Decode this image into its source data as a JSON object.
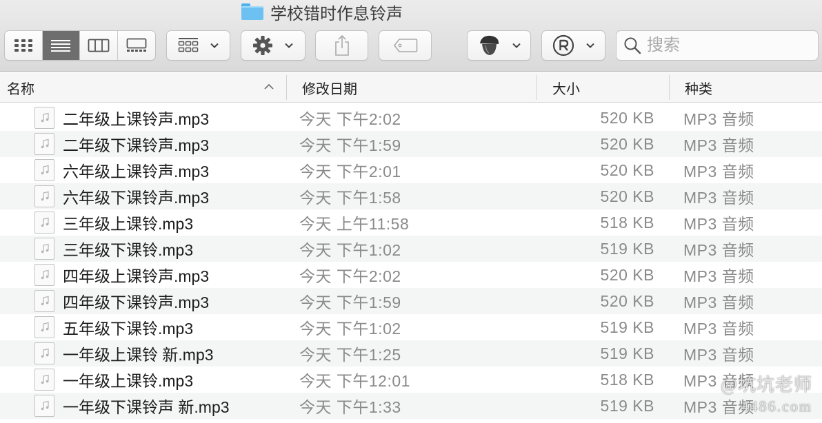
{
  "window": {
    "title": "学校错时作息铃声",
    "folder_icon": "folder-icon"
  },
  "toolbar": {
    "view_modes": [
      {
        "name": "icon-view",
        "icon": "grid-icon",
        "active": false
      },
      {
        "name": "list-view",
        "icon": "list-icon",
        "active": true
      },
      {
        "name": "column-view",
        "icon": "columns-icon",
        "active": false
      },
      {
        "name": "gallery-view",
        "icon": "gallery-icon",
        "active": false
      }
    ],
    "group_button_icon": "group-icon",
    "action_button_icon": "gear-icon",
    "share_button_icon": "share-icon",
    "tag_button_icon": "tag-icon",
    "acorn_button_icon": "acorn-icon",
    "registered_button_icon": "registered-icon",
    "search": {
      "placeholder": "搜索",
      "value": ""
    }
  },
  "columns": {
    "name": "名称",
    "date": "修改日期",
    "size": "大小",
    "kind": "种类",
    "sort_column": "name",
    "sort_direction": "ascending"
  },
  "files": [
    {
      "name": "二年级上课铃声.mp3",
      "date": "今天 下午2:02",
      "size": "520 KB",
      "kind": "MP3 音频"
    },
    {
      "name": "二年级下课铃声.mp3",
      "date": "今天 下午1:59",
      "size": "520 KB",
      "kind": "MP3 音频"
    },
    {
      "name": "六年级上课铃声.mp3",
      "date": "今天 下午2:01",
      "size": "520 KB",
      "kind": "MP3 音频"
    },
    {
      "name": "六年级下课铃声.mp3",
      "date": "今天 下午1:58",
      "size": "520 KB",
      "kind": "MP3 音频"
    },
    {
      "name": "三年级上课铃.mp3",
      "date": "今天 上午11:58",
      "size": "518 KB",
      "kind": "MP3 音频"
    },
    {
      "name": "三年级下课铃.mp3",
      "date": "今天 下午1:02",
      "size": "519 KB",
      "kind": "MP3 音频"
    },
    {
      "name": "四年级上课铃声.mp3",
      "date": "今天 下午2:02",
      "size": "520 KB",
      "kind": "MP3 音频"
    },
    {
      "name": "四年级下课铃声.mp3",
      "date": "今天 下午1:59",
      "size": "520 KB",
      "kind": "MP3 音频"
    },
    {
      "name": "五年级下课铃.mp3",
      "date": "今天 下午1:02",
      "size": "519 KB",
      "kind": "MP3 音频"
    },
    {
      "name": "一年级上课铃 新.mp3",
      "date": "今天 下午1:25",
      "size": "519 KB",
      "kind": "MP3 音频"
    },
    {
      "name": "一年级上课铃.mp3",
      "date": "今天 下午12:01",
      "size": "518 KB",
      "kind": "MP3 音频"
    },
    {
      "name": "一年级下课铃声 新.mp3",
      "date": "今天 下午1:33",
      "size": "519 KB",
      "kind": "MP3 音频"
    }
  ],
  "watermark": {
    "line1": "@坑坑老师",
    "line2": "4486.com"
  }
}
